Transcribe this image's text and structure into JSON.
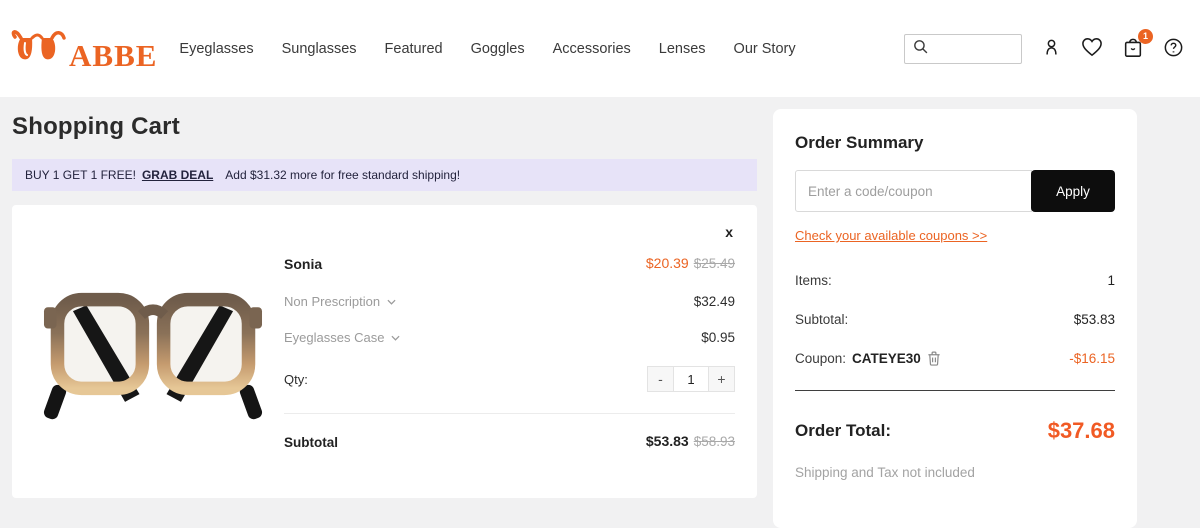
{
  "brand": {
    "name": "ABBE",
    "accent_color": "#eb6423"
  },
  "header": {
    "nav": [
      "Eyeglasses",
      "Sunglasses",
      "Featured",
      "Goggles",
      "Accessories",
      "Lenses",
      "Our Story"
    ],
    "search_placeholder": "",
    "cart_badge": "1",
    "icons": {
      "search": "magnifier",
      "account": "person",
      "wishlist": "heart",
      "cart": "shopping-bag",
      "help": "question-circle"
    }
  },
  "page": {
    "title": "Shopping Cart",
    "background_color": "#f1f1f2"
  },
  "promo": {
    "deal_text": "BUY 1 GET 1 FREE!",
    "deal_link": "GRAB DEAL",
    "shipping_text": "Add $31.32 more for free standard shipping!",
    "background_color": "#e7e3f8"
  },
  "cart_item": {
    "close_label": "x",
    "name": "Sonia",
    "sale_price": "$20.39",
    "original_price": "$25.49",
    "options": [
      {
        "label": "Non Prescription",
        "price": "$32.49"
      },
      {
        "label": "Eyeglasses Case",
        "price": "$0.95"
      }
    ],
    "qty_label": "Qty:",
    "qty_minus": "-",
    "qty_value": "1",
    "qty_plus": "+",
    "subtotal_label": "Subtotal",
    "subtotal_price": "$53.83",
    "subtotal_original": "$58.93"
  },
  "summary": {
    "title": "Order Summary",
    "coupon_placeholder": "Enter a code/coupon",
    "apply_label": "Apply",
    "apply_bg": "#0d0d0d",
    "coupons_link": "Check your available coupons >>",
    "items_label": "Items:",
    "items_value": "1",
    "subtotal_label": "Subtotal:",
    "subtotal_value": "$53.83",
    "coupon_label": "Coupon:",
    "coupon_code": "CATEYE30",
    "coupon_value": "-$16.15",
    "total_label": "Order Total:",
    "total_value": "$37.68",
    "total_color": "#f15a24",
    "note": "Shipping and Tax not included"
  }
}
